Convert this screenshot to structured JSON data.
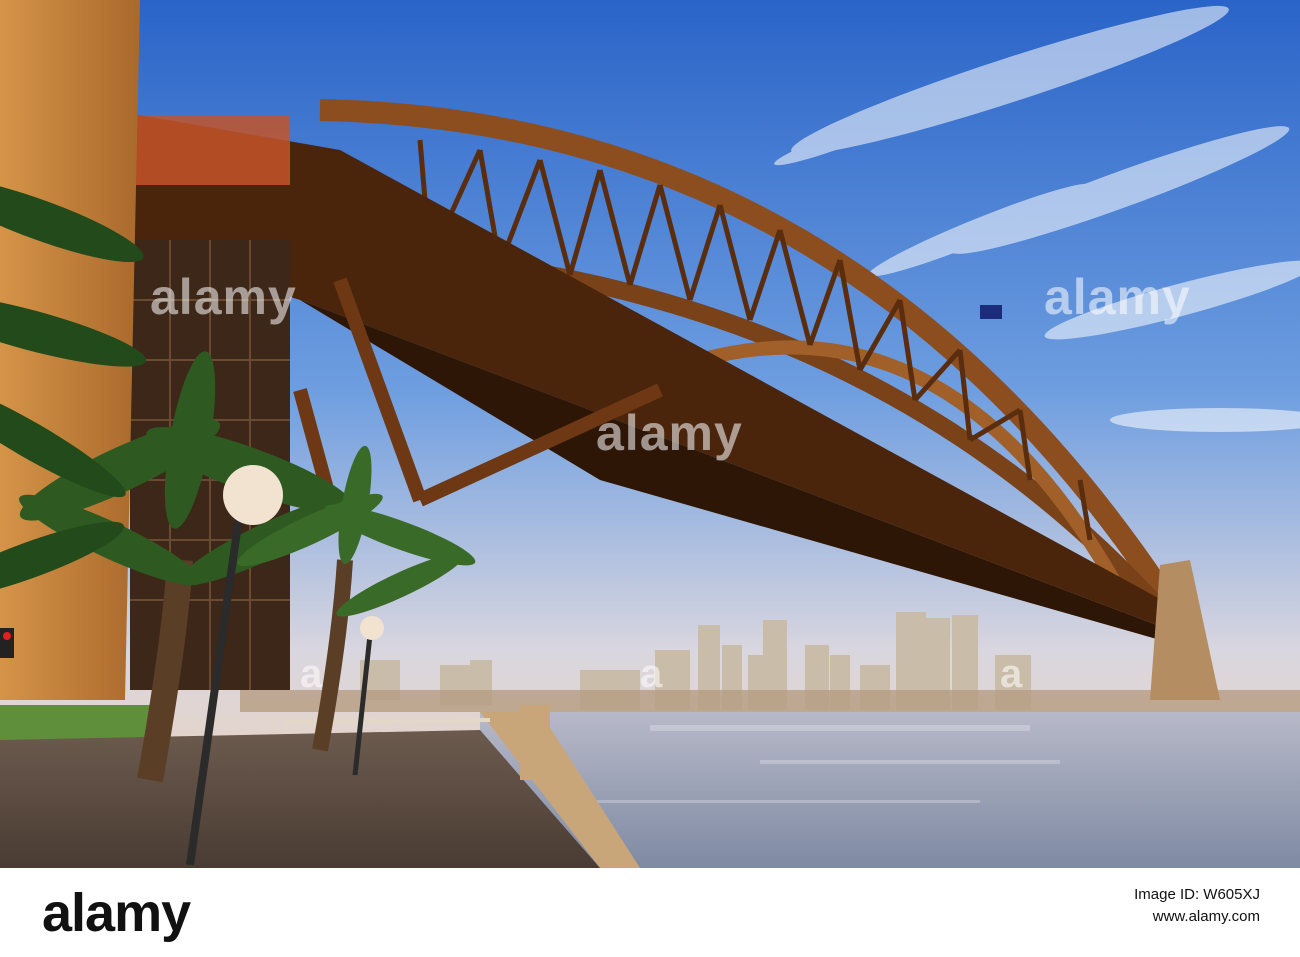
{
  "photo": {
    "subject": "Sydney Harbour Bridge at sunrise",
    "colors": {
      "sky_top": "#2f6fd1",
      "sky_bottom": "#f3d6b4",
      "steel": "#8a4a1c",
      "steel_dark": "#3a1f0c",
      "water": "#9aa3b6",
      "stone": "#c8893e"
    }
  },
  "watermarks": {
    "left": "alamy",
    "center": "alamy",
    "right": "alamy",
    "lower_left": "a",
    "lower_center": "a",
    "lower_right": "a"
  },
  "footer": {
    "logo": "alamy",
    "image_id": "Image ID: W605XJ",
    "url": "www.alamy.com"
  }
}
